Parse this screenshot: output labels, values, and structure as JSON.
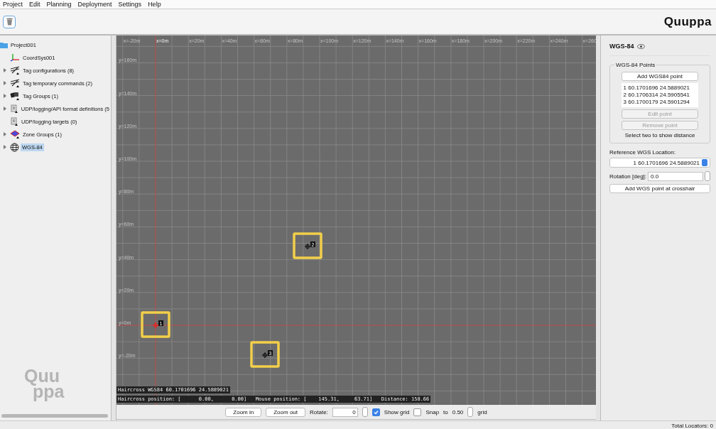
{
  "menu": [
    "Project",
    "Edit",
    "Planning",
    "Deployment",
    "Settings",
    "Help"
  ],
  "logo": "Quuppa",
  "tree": {
    "label": "Project001",
    "kind": "folder",
    "selected": false,
    "children": [
      {
        "label": "CoordSys001",
        "kind": "axes",
        "selected": false
      },
      {
        "label": "Tag configurations (8)",
        "kind": "tags",
        "selected": false,
        "expanded": false
      },
      {
        "label": "Tag temporary commands (2)",
        "kind": "tags",
        "selected": false,
        "expanded": false
      },
      {
        "label": "Tag Groups (1)",
        "kind": "group",
        "selected": false,
        "expanded": false
      },
      {
        "label": "UDP/logging/API format definitions (5",
        "kind": "udp",
        "selected": false,
        "expanded": false
      },
      {
        "label": "UDP/logging targets (0)",
        "kind": "udp",
        "selected": false
      },
      {
        "label": "Zone Groups (1)",
        "kind": "zone",
        "selected": false,
        "expanded": false
      },
      {
        "label": "WGS-84",
        "kind": "globe",
        "selected": true,
        "expanded": false
      }
    ]
  },
  "tree_watermark": [
    "Quu",
    "ppa"
  ],
  "canvas": {
    "x_labels": [
      "x=-20m",
      "x=0m",
      "x=20m",
      "x=40m",
      "x=60m",
      "x=80m",
      "x=100m",
      "x=120m",
      "x=140m",
      "x=160m",
      "x=180m",
      "x=200m",
      "x=220m",
      "x=240m",
      "x=260"
    ],
    "y_labels": [
      "y=160m",
      "y=140m",
      "y=120m",
      "y=100m",
      "y=80m",
      "y=60m",
      "y=40m",
      "y=20m",
      "y=0m",
      "y=-20m"
    ],
    "points": [
      {
        "label": "1",
        "kind": "haircross",
        "highlighted": true
      },
      {
        "label": "2",
        "kind": "point",
        "highlighted": true
      },
      {
        "label": "3",
        "kind": "point",
        "highlighted": true
      }
    ],
    "haircross_wgs": "Haircross WGS84 60.1701696 24.5889021",
    "positions": "Haircross position: [      0.00,      0.00]   Mouse position: [    145.31,     63.71]   Distance: 158.66"
  },
  "controls": {
    "zoom_in": "Zoom in",
    "zoom_out": "Zoom out",
    "rotate_label": "Rotate:",
    "rotate_value": "0",
    "show_grid": {
      "label": "Show grid",
      "checked": true
    },
    "snap": {
      "label": "Snap",
      "checked": false
    },
    "to_label": "to",
    "snap_value": "0.50",
    "grid_label": "grid"
  },
  "panel": {
    "title": "WGS-84",
    "group_title": "WGS-84 Points",
    "add_button": "Add WGS84 point",
    "points": [
      "1 60.1701696 24.5889021",
      "2 60.1706314 24.5905541",
      "3 60.1700179 24.5901294"
    ],
    "edit_button": {
      "label": "Edit point",
      "disabled": true
    },
    "remove_button": {
      "label": "Remove point",
      "disabled": true
    },
    "hint": "Select two to show distance",
    "reference_label": "Reference WGS Location:",
    "reference_value": "1 60.1701696 24.5889021",
    "rotation_label": "Rotation [deg]:",
    "rotation_value": "0.0",
    "crosshair_button": "Add WGS point at crosshair"
  },
  "status": "Total Locators: 0"
}
